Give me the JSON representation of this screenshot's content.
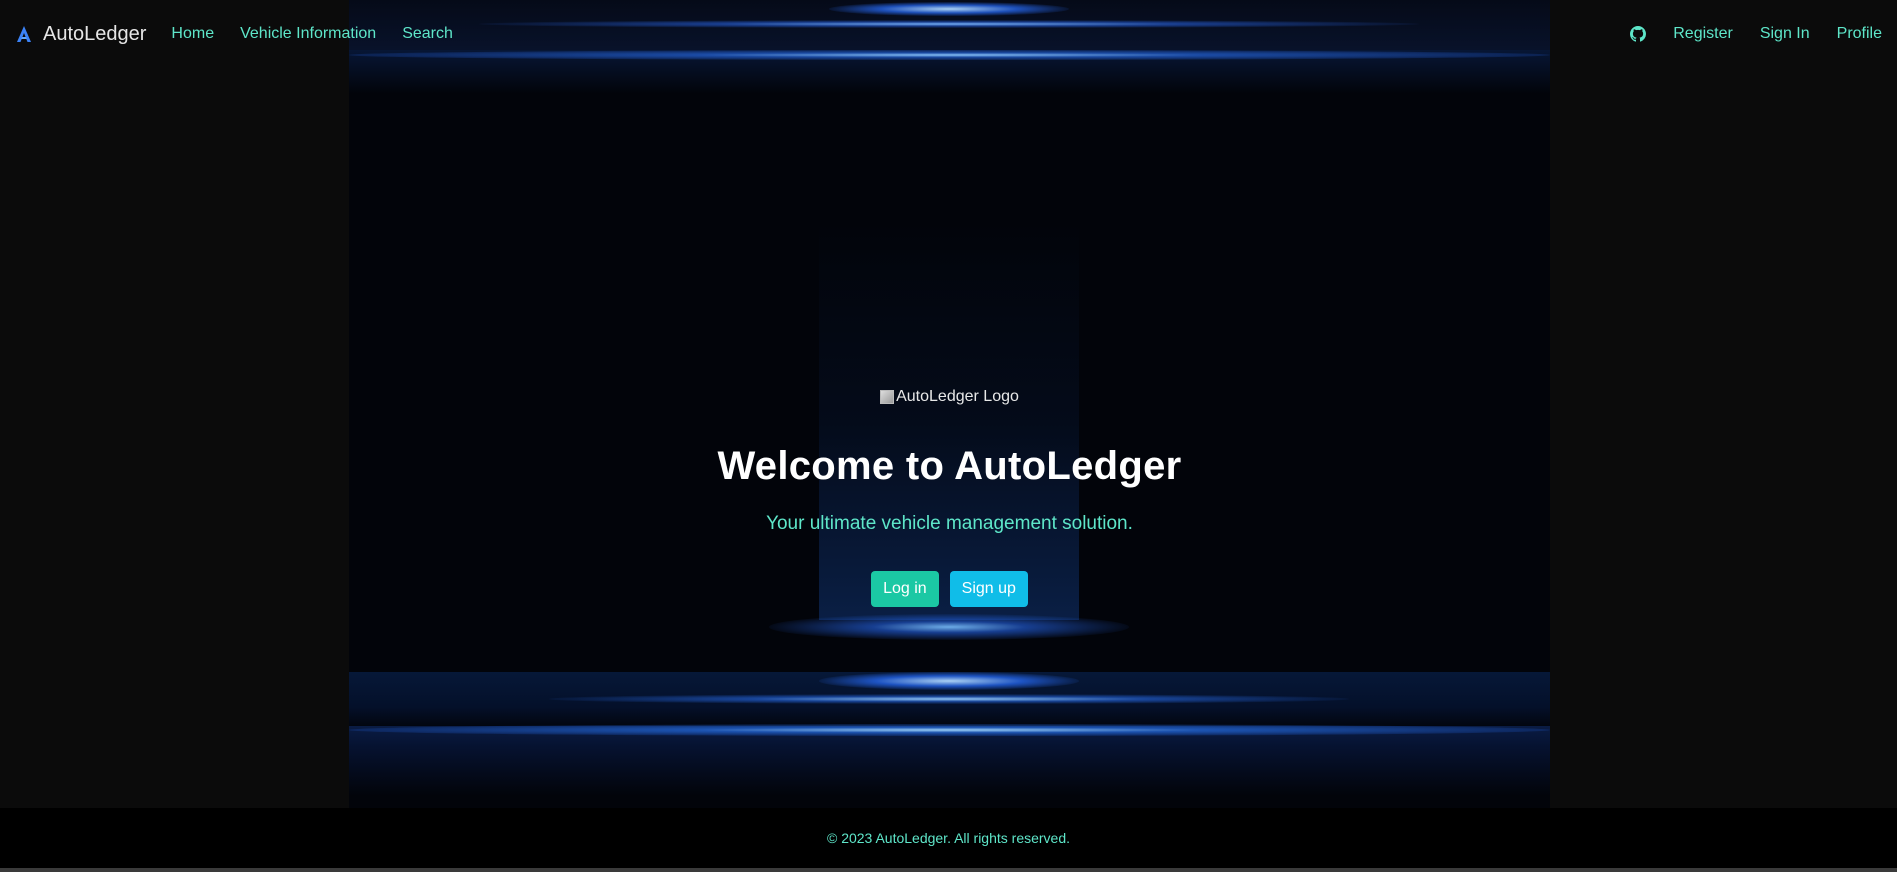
{
  "app": {
    "brand": "AutoLedger"
  },
  "nav": {
    "left": [
      {
        "label": "Home"
      },
      {
        "label": "Vehicle Information"
      },
      {
        "label": "Search"
      }
    ],
    "right": {
      "github_icon": "github-icon",
      "register": "Register",
      "sign_in": "Sign In",
      "profile": "Profile"
    }
  },
  "hero": {
    "logo_alt": "AutoLedger Logo",
    "title": "Welcome to AutoLedger",
    "subtitle": "Your ultimate vehicle management solution.",
    "login_label": "Log in",
    "signup_label": "Sign up"
  },
  "footer": {
    "text": "© 2023 AutoLedger. All rights reserved."
  },
  "colors": {
    "accent": "#5ee6c9",
    "login_button": "#1bc8a4",
    "signup_button": "#10bde8",
    "page_background": "#0b0b0b",
    "hero_background": "#02040a",
    "glow": "#2a7bff"
  }
}
